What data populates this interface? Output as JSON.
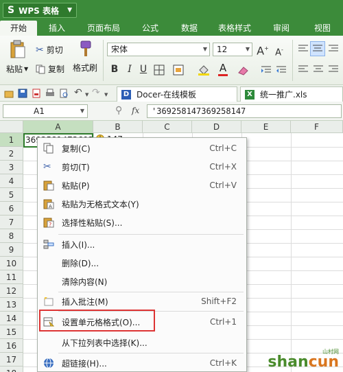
{
  "app": {
    "title": "WPS 表格",
    "logo": "S"
  },
  "tabs": [
    "开始",
    "插入",
    "页面布局",
    "公式",
    "数据",
    "表格样式",
    "审阅",
    "视图"
  ],
  "ribbon": {
    "paste": "粘贴",
    "cut": "剪切",
    "copy": "复制",
    "format_painter": "格式刷",
    "font_name": "宋体",
    "font_size": "12",
    "bold": "B",
    "italic": "I",
    "underline": "U"
  },
  "doc_tabs": [
    "Docer-在线模板",
    "统一推广.xls"
  ],
  "formula_bar": {
    "name_box": "A1",
    "fx": "fx",
    "formula": "'369258147369258147"
  },
  "grid": {
    "columns": [
      "A",
      "B",
      "C",
      "D",
      "E",
      "F"
    ],
    "rows": [
      "1",
      "2",
      "3",
      "4",
      "5",
      "6",
      "7",
      "8",
      "9",
      "10",
      "11",
      "12",
      "13",
      "14",
      "15",
      "16",
      "17",
      "18"
    ],
    "a1_value": "3692581473692",
    "b1_value": "147"
  },
  "context_menu": {
    "items": [
      {
        "label": "复制(C)",
        "shortcut": "Ctrl+C",
        "icon": "copy-icon"
      },
      {
        "label": "剪切(T)",
        "shortcut": "Ctrl+X",
        "icon": "scissors-icon"
      },
      {
        "label": "粘贴(P)",
        "shortcut": "Ctrl+V",
        "icon": "paste-icon"
      },
      {
        "label": "粘贴为无格式文本(Y)",
        "shortcut": "",
        "icon": "paste-text-icon"
      },
      {
        "label": "选择性粘贴(S)...",
        "shortcut": "",
        "icon": "paste-special-icon"
      },
      {
        "label": "插入(I)...",
        "shortcut": "",
        "icon": "insert-icon"
      },
      {
        "label": "删除(D)...",
        "shortcut": "",
        "icon": ""
      },
      {
        "label": "清除内容(N)",
        "shortcut": "",
        "icon": ""
      },
      {
        "label": "插入批注(M)",
        "shortcut": "Shift+F2",
        "icon": "comment-icon"
      },
      {
        "label": "设置单元格格式(O)...",
        "shortcut": "Ctrl+1",
        "icon": "format-cells-icon"
      },
      {
        "label": "从下拉列表中选择(K)...",
        "shortcut": "",
        "icon": ""
      },
      {
        "label": "超链接(H)...",
        "shortcut": "Ctrl+K",
        "icon": "hyperlink-icon"
      }
    ]
  },
  "watermark": {
    "brand_a": "shan",
    "brand_b": "cun",
    "sub": "山村网"
  },
  "colors": {
    "ribbon_green": "#3c8b3a",
    "selection_green": "#2d7d2a",
    "highlight_red": "#dd3333"
  }
}
